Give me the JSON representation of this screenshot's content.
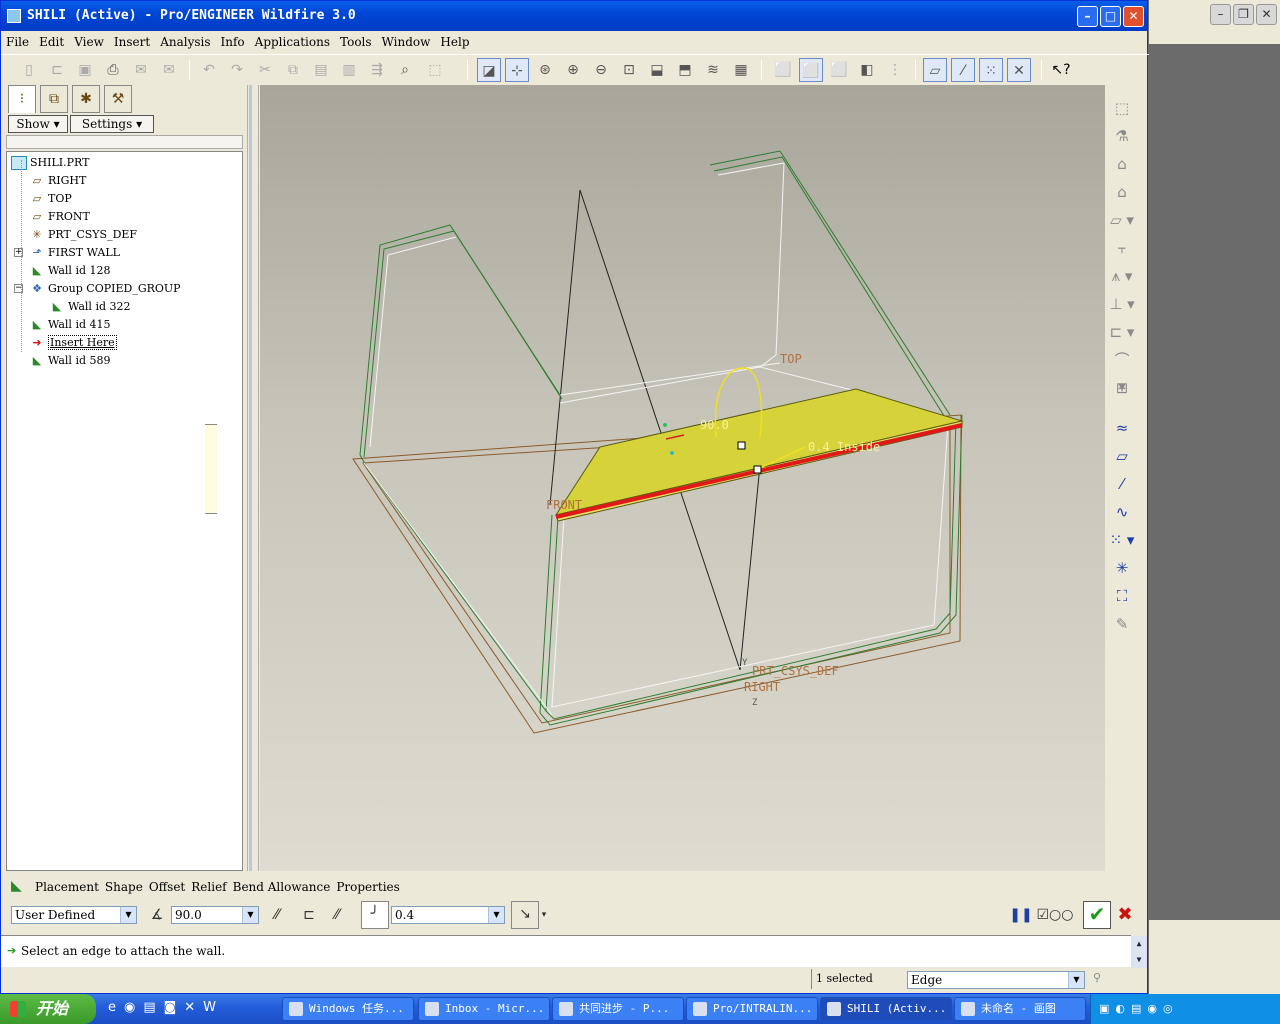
{
  "window": {
    "title": "SHILI (Active) - Pro/ENGINEER Wildfire 3.0",
    "caption_buttons": [
      "minimize",
      "maximize",
      "close"
    ]
  },
  "menu": [
    "File",
    "Edit",
    "View",
    "Insert",
    "Analysis",
    "Info",
    "Applications",
    "Tools",
    "Window",
    "Help"
  ],
  "nav": {
    "show_label": "Show",
    "settings_label": "Settings",
    "tree": [
      {
        "label": "SHILI.PRT",
        "icon": "part-icon"
      },
      {
        "label": "RIGHT",
        "icon": "datum-plane-icon"
      },
      {
        "label": "TOP",
        "icon": "datum-plane-icon"
      },
      {
        "label": "FRONT",
        "icon": "datum-plane-icon"
      },
      {
        "label": "PRT_CSYS_DEF",
        "icon": "csys-icon"
      },
      {
        "label": "FIRST WALL",
        "icon": "first-wall-icon"
      },
      {
        "label": "Wall id 128",
        "icon": "wall-icon"
      },
      {
        "label": "Group COPIED_GROUP",
        "icon": "group-icon"
      },
      {
        "label": "Wall id 322",
        "icon": "wall-icon"
      },
      {
        "label": "Wall id 415",
        "icon": "wall-icon"
      },
      {
        "label": "Insert Here",
        "icon": "insert-arrow-icon"
      },
      {
        "label": "Wall id 589",
        "icon": "wall-icon"
      }
    ]
  },
  "viewport": {
    "labels": {
      "top": "TOP",
      "front": "FRONT",
      "csys": "PRT_CSYS_DEF",
      "right": "RIGHT",
      "angle": "90.0",
      "thickness": "0.4 Inside",
      "y_axis": "Y",
      "z_axis": "Z"
    },
    "colors": {
      "wall_face": "#d6d23a",
      "attach_edge": "#e01818",
      "edge_green": "#2e7d32",
      "datum_brown": "#8a5a2a"
    }
  },
  "dashboard": {
    "tabs": [
      "Placement",
      "Shape",
      "Offset",
      "Relief",
      "Bend Allowance",
      "Properties"
    ],
    "shape_type": "User Defined",
    "angle_value": "90.0",
    "thickness_value": "0.4"
  },
  "message": "Select an edge to attach the wall.",
  "status": {
    "selected": "1 selected",
    "filter": "Edge"
  },
  "taskbar": {
    "start": "开始",
    "tasks": [
      {
        "label": "Windows 任务...",
        "active": false
      },
      {
        "label": "Inbox - Micr...",
        "active": false
      },
      {
        "label": "共同进步 - P...",
        "active": false
      },
      {
        "label": "Pro/INTRALIN...",
        "active": false
      },
      {
        "label": "SHILI (Activ...",
        "active": true
      },
      {
        "label": "未命名 - 画图",
        "active": false
      }
    ]
  }
}
